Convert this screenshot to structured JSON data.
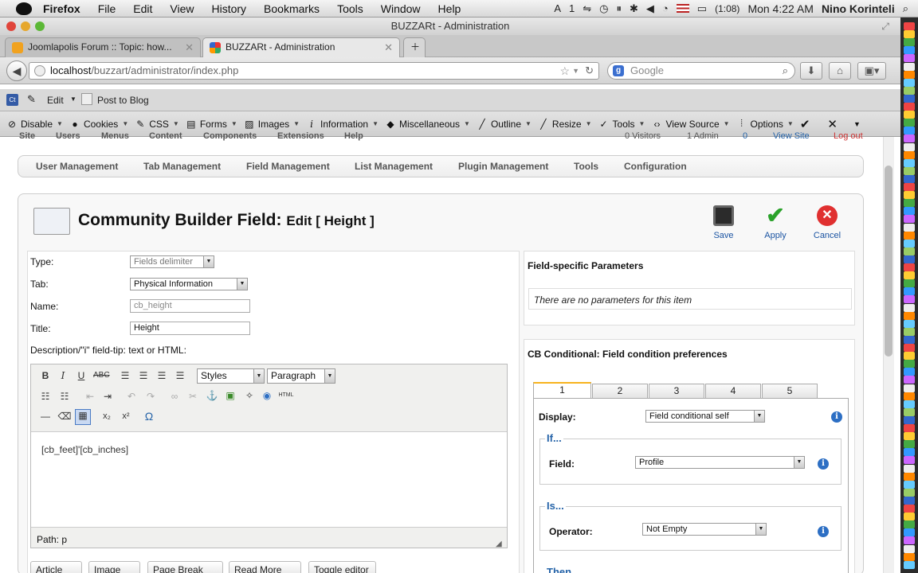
{
  "menubar": {
    "app": "Firefox",
    "items": [
      "File",
      "Edit",
      "View",
      "History",
      "Bookmarks",
      "Tools",
      "Window",
      "Help"
    ],
    "status": {
      "adobe_count": "1",
      "battery": "(1:08)",
      "clock": "Mon 4:22 AM",
      "user": "Nino Korinteli"
    }
  },
  "window": {
    "title": "BUZZARt - Administration"
  },
  "tabs": [
    {
      "label": "Joomlapolis Forum :: Topic: how..."
    },
    {
      "label": "BUZZARt - Administration"
    }
  ],
  "nav": {
    "url_host": "localhost",
    "url_path": "/buzzart/administrator/index.php",
    "search_placeholder": "Google"
  },
  "bookmarks": {
    "edit": "Edit",
    "post": "Post to Blog"
  },
  "webdev": [
    "Disable",
    "Cookies",
    "CSS",
    "Forms",
    "Images",
    "Information",
    "Miscellaneous",
    "Outline",
    "Resize",
    "Tools",
    "View Source",
    "Options"
  ],
  "admin": {
    "topnav": [
      "Site",
      "Users",
      "Menus",
      "Content",
      "Components",
      "Extensions",
      "Help"
    ],
    "status": {
      "visitors": "0 Visitors",
      "admin": "1 Admin",
      "messages": "0",
      "view_site": "View Site",
      "logout": "Log out"
    },
    "subnav": [
      "User Management",
      "Tab Management",
      "Field Management",
      "List Management",
      "Plugin Management",
      "Tools",
      "Configuration"
    ],
    "page_title": "Community Builder Field:",
    "page_subtitle": "Edit [ Height ]",
    "toolbar": {
      "save": "Save",
      "apply": "Apply",
      "cancel": "Cancel"
    }
  },
  "form": {
    "type_label": "Type:",
    "type_value": "Fields delimiter",
    "tab_label": "Tab:",
    "tab_value": "Physical Information",
    "name_label": "Name:",
    "name_value": "cb_height",
    "title_label": "Title:",
    "title_value": "Height",
    "desc_label": "Description/\"i\" field-tip: text or HTML:"
  },
  "editor": {
    "styles": "Styles",
    "format": "Paragraph",
    "content": "[cb_feet]'[cb_inches]",
    "path": "Path: p",
    "buttons": [
      "Article",
      "Image",
      "Page Break",
      "Read More",
      "Toggle editor"
    ]
  },
  "params": {
    "heading": "Field-specific Parameters",
    "empty_message": "There are no parameters for this item"
  },
  "conditional": {
    "heading": "CB Conditional: Field condition preferences",
    "tabs": [
      "1",
      "2",
      "3",
      "4",
      "5"
    ],
    "display_label": "Display:",
    "display_value": "Field conditional self",
    "if_legend": "If...",
    "field_label": "Field:",
    "field_value": "Profile",
    "is_legend": "Is...",
    "operator_label": "Operator:",
    "operator_value": "Not Empty",
    "then_legend": "Then"
  }
}
